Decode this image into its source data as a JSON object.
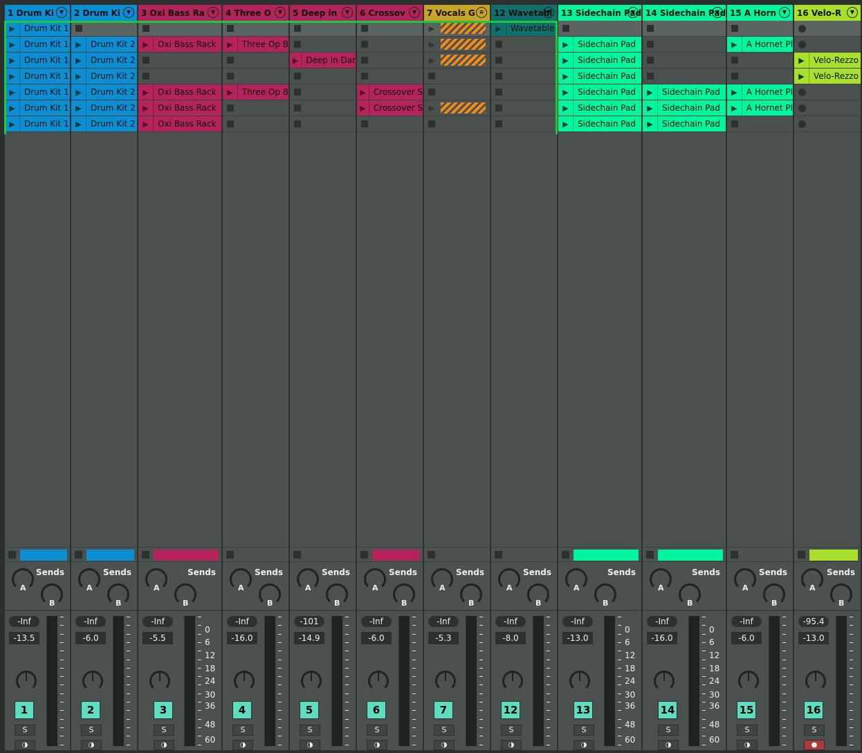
{
  "colors": {
    "blue": "#0b8fd2",
    "pink": "#b3235c",
    "yellow": "#c9a42a",
    "teal": "#11706c",
    "green": "#00f59c",
    "lime": "#a8e02c",
    "selection": "#1cc83c",
    "track_number_bg": "#5ddcc0"
  },
  "sends_label": "Sends",
  "send_a": "A",
  "send_b": "B",
  "solo_label": "S",
  "scale": [
    "0",
    "6",
    "12",
    "18",
    "24",
    "30",
    "36",
    "48",
    "60"
  ],
  "tracks": [
    {
      "name": "1 Drum Ki",
      "color": "blue",
      "num": "1",
      "peak": "-Inf",
      "volume": "-13.5",
      "slots": [
        "Drum Kit 1",
        "Drum Kit 1",
        "Drum Kit 1",
        "Drum Kit 1",
        "Drum Kit 1",
        "Drum Kit 1",
        "Drum Kit 1"
      ]
    },
    {
      "name": "2 Drum Ki",
      "color": "blue",
      "num": "2",
      "peak": "-Inf",
      "volume": "-6.0",
      "slots": [
        null,
        "Drum Kit 2",
        "Drum Kit 2",
        "Drum Kit 2",
        "Drum Kit 2",
        "Drum Kit 2",
        "Drum Kit 2"
      ]
    },
    {
      "name": "3 Oxi Bass Ra",
      "color": "pink",
      "num": "3",
      "peak": "-Inf",
      "volume": "-5.5",
      "scale": true,
      "slots": [
        null,
        "Oxi Bass Rack",
        null,
        null,
        "Oxi Bass Rack",
        "Oxi Bass Rack",
        "Oxi Bass Rack"
      ]
    },
    {
      "name": "4 Three O",
      "color": "pink",
      "num": "4",
      "peak": "-Inf",
      "volume": "-16.0",
      "slots": [
        null,
        "Three Op B",
        null,
        null,
        "Three Op B",
        null,
        null
      ]
    },
    {
      "name": "5 Deep in",
      "color": "pink",
      "num": "5",
      "peak": "-101",
      "volume": "-14.9",
      "slots": [
        null,
        null,
        "Deep in Dar",
        null,
        null,
        null,
        null
      ]
    },
    {
      "name": "6 Crossov",
      "color": "pink",
      "num": "6",
      "peak": "-Inf",
      "volume": "-6.0",
      "slots": [
        null,
        null,
        null,
        null,
        "Crossover S",
        "Crossover S",
        null
      ]
    },
    {
      "name": "7 Vocals G",
      "color": "yellow",
      "num": "7",
      "peak": "-Inf",
      "volume": "-5.3",
      "group": true,
      "slots": [
        "~",
        "~",
        "~",
        null,
        null,
        "~",
        null
      ]
    },
    {
      "name": "12 Wavetabl",
      "color": "teal",
      "num": "12",
      "peak": "-Inf",
      "volume": "-8.0",
      "slots": [
        "Wavetable",
        null,
        null,
        null,
        null,
        null,
        null
      ]
    },
    {
      "name": "13 Sidechain Pad",
      "color": "green",
      "num": "13",
      "peak": "-Inf",
      "volume": "-13.0",
      "scale": true,
      "slots": [
        null,
        "Sidechain Pad",
        "Sidechain Pad",
        "Sidechain Pad",
        "Sidechain Pad",
        "Sidechain Pad",
        "Sidechain Pad"
      ]
    },
    {
      "name": "14 Sidechain Pad",
      "color": "green",
      "num": "14",
      "peak": "-Inf",
      "volume": "-16.0",
      "scale": true,
      "slots": [
        null,
        null,
        null,
        null,
        "Sidechain Pad",
        "Sidechain Pad",
        "Sidechain Pad"
      ]
    },
    {
      "name": "15 A Horn",
      "color": "green",
      "num": "15",
      "peak": "-Inf",
      "volume": "-6.0",
      "slots": [
        null,
        "A Hornet Pl",
        null,
        null,
        "A Hornet Pl",
        "A Hornet Pl",
        null
      ]
    },
    {
      "name": "16 Velo-R",
      "color": "lime",
      "num": "16",
      "peak": "-95.4",
      "volume": "-13.0",
      "armed": true,
      "slots": [
        "o",
        "o",
        "Velo-Rezzo",
        "Velo-Rezzo",
        "o",
        "o",
        "o"
      ]
    }
  ]
}
